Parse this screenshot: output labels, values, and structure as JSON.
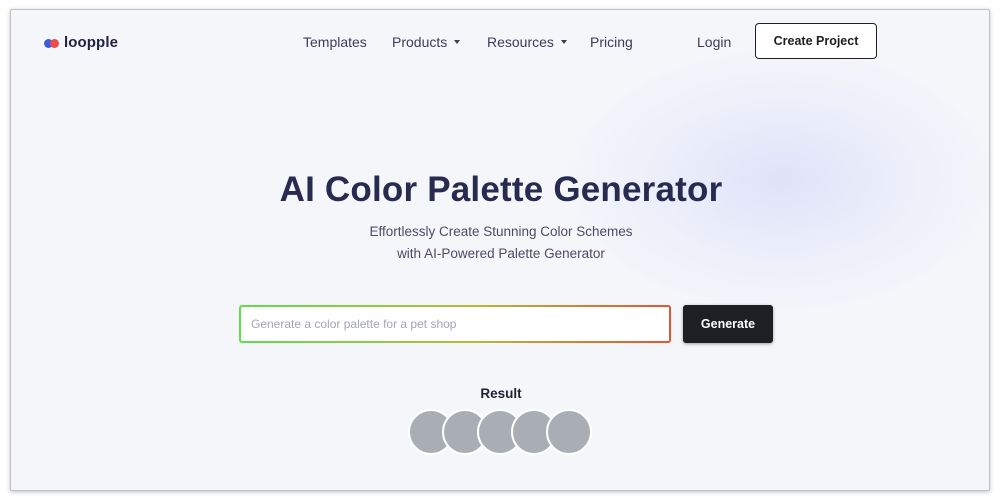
{
  "brand": {
    "name": "loopple"
  },
  "nav": {
    "templates": "Templates",
    "products": "Products",
    "resources": "Resources",
    "pricing": "Pricing",
    "login": "Login",
    "create_project": "Create Project"
  },
  "hero": {
    "title": "AI Color Palette Generator",
    "subtitle_line1": "Effortlessly Create Stunning Color Schemes",
    "subtitle_line2": "with AI-Powered Palette Generator"
  },
  "generator": {
    "placeholder": "Generate a color palette for a pet shop",
    "value": "",
    "button_label": "Generate"
  },
  "result": {
    "label": "Result",
    "swatches": [
      "#a9aeb5",
      "#a9aeb5",
      "#a9aeb5",
      "#a9aeb5",
      "#a9aeb5"
    ]
  },
  "colors": {
    "title": "#272b4f",
    "primary_button": "#1c1f24",
    "logo_blue": "#3b5bd9",
    "logo_red": "#ef4a4a"
  }
}
